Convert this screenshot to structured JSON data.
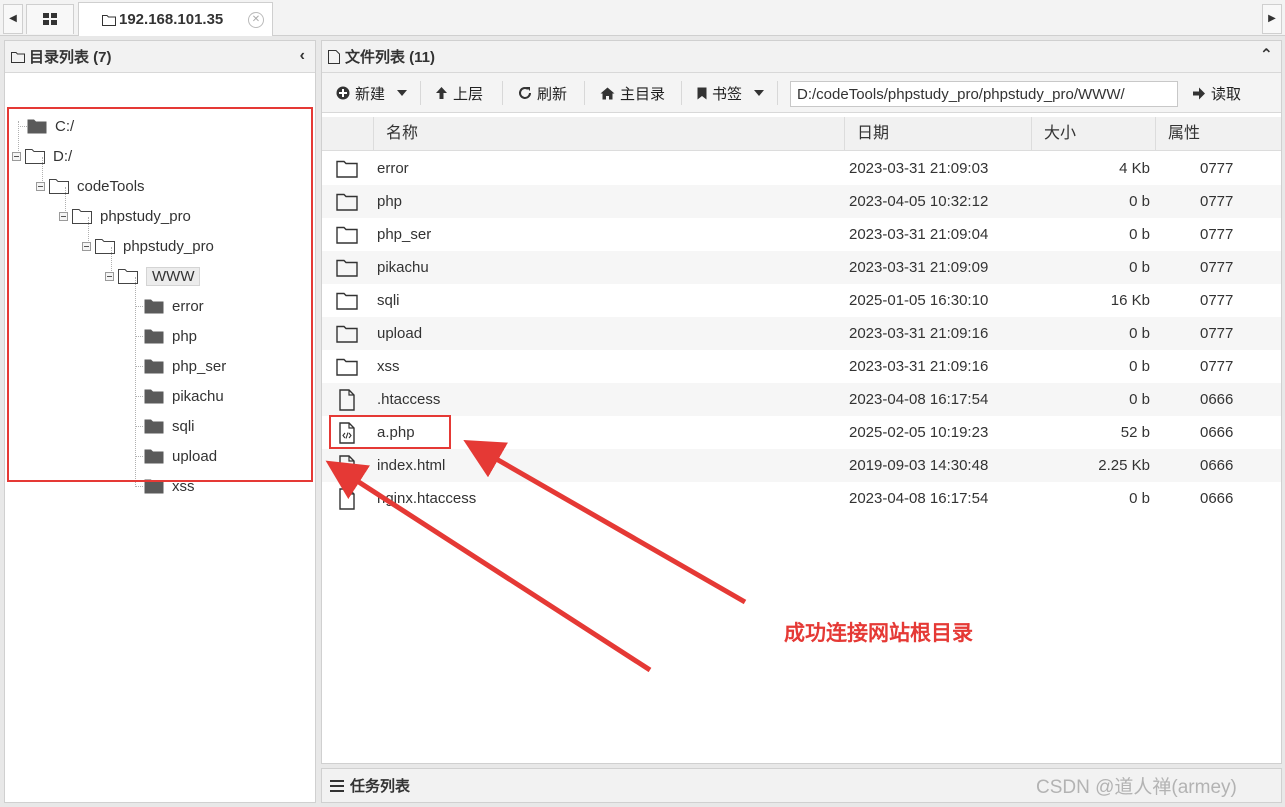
{
  "tab": {
    "host": "192.168.101.35"
  },
  "dir_panel": {
    "title": "目录列表 (7)"
  },
  "tree": [
    {
      "label": "C:/"
    },
    {
      "label": "D:/"
    },
    {
      "label": "codeTools"
    },
    {
      "label": "phpstudy_pro"
    },
    {
      "label": "phpstudy_pro"
    },
    {
      "label": "WWW",
      "selected": true
    },
    {
      "label": "error"
    },
    {
      "label": "php"
    },
    {
      "label": "php_ser"
    },
    {
      "label": "pikachu"
    },
    {
      "label": "sqli"
    },
    {
      "label": "upload"
    },
    {
      "label": "xss"
    }
  ],
  "file_panel": {
    "title": "文件列表 (11)"
  },
  "toolbar": {
    "new_label": "新建",
    "up_label": "上层",
    "refresh_label": "刷新",
    "home_label": "主目录",
    "bookmark_label": "书签",
    "path": "D:/codeTools/phpstudy_pro/phpstudy_pro/WWW/",
    "read_label": "读取"
  },
  "columns": {
    "name": "名称",
    "date": "日期",
    "size": "大小",
    "attr": "属性"
  },
  "files": [
    {
      "name": "error",
      "date": "2023-03-31 21:09:03",
      "size": "4 Kb",
      "attr": "0777",
      "type": "folder"
    },
    {
      "name": "php",
      "date": "2023-04-05 10:32:12",
      "size": "0 b",
      "attr": "0777",
      "type": "folder"
    },
    {
      "name": "php_ser",
      "date": "2023-03-31 21:09:04",
      "size": "0 b",
      "attr": "0777",
      "type": "folder"
    },
    {
      "name": "pikachu",
      "date": "2023-03-31 21:09:09",
      "size": "0 b",
      "attr": "0777",
      "type": "folder"
    },
    {
      "name": "sqli",
      "date": "2025-01-05 16:30:10",
      "size": "16 Kb",
      "attr": "0777",
      "type": "folder"
    },
    {
      "name": "upload",
      "date": "2023-03-31 21:09:16",
      "size": "0 b",
      "attr": "0777",
      "type": "folder"
    },
    {
      "name": "xss",
      "date": "2023-03-31 21:09:16",
      "size": "0 b",
      "attr": "0777",
      "type": "folder"
    },
    {
      "name": ".htaccess",
      "date": "2023-04-08 16:17:54",
      "size": "0 b",
      "attr": "0666",
      "type": "file"
    },
    {
      "name": "a.php",
      "date": "2025-02-05 10:19:23",
      "size": "52 b",
      "attr": "0666",
      "type": "code"
    },
    {
      "name": "index.html",
      "date": "2019-09-03 14:30:48",
      "size": "2.25 Kb",
      "attr": "0666",
      "type": "code"
    },
    {
      "name": "nginx.htaccess",
      "date": "2023-04-08 16:17:54",
      "size": "0 b",
      "attr": "0666",
      "type": "file"
    }
  ],
  "task_panel": {
    "title": "任务列表"
  },
  "annotation": {
    "text": "成功连接网站根目录",
    "color": "#e53935"
  },
  "watermark": {
    "text": "CSDN @道人禅(armey)"
  },
  "icons": {
    "folder_open": "folder-outline-icon",
    "folder_filled": "folder-solid-icon",
    "file": "file-icon",
    "code_file": "code-file-icon"
  }
}
